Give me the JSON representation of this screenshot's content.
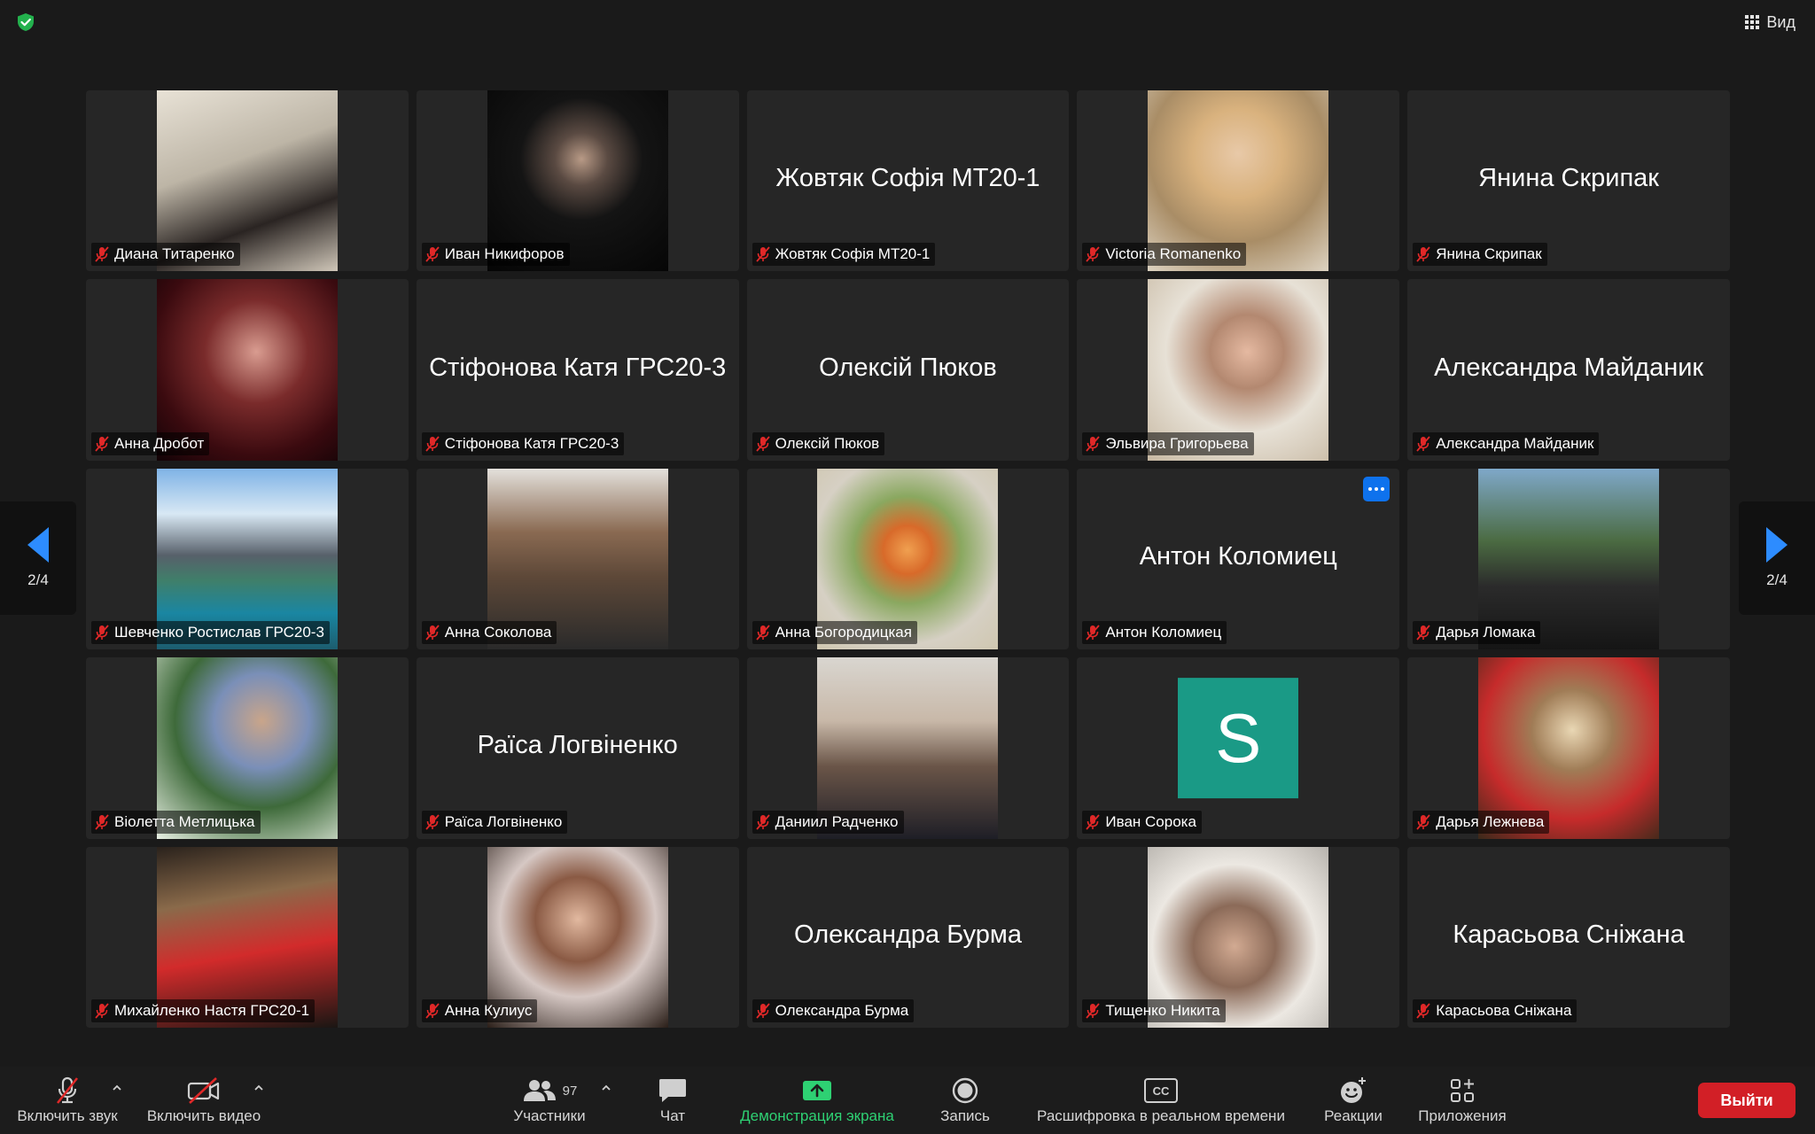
{
  "topbar": {
    "view_label": "Вид"
  },
  "pagination": {
    "left_label": "2/4",
    "right_label": "2/4"
  },
  "tiles": [
    {
      "name": "Диана Титаренко",
      "type": "video",
      "photo": "ph1"
    },
    {
      "name": "Иван Никифоров",
      "type": "video",
      "photo": "ph2"
    },
    {
      "name": "Жовтяк Софія МТ20-1",
      "type": "name",
      "big_name": "Жовтяк Софія МТ20-1"
    },
    {
      "name": "Victoria Romanenko",
      "type": "video",
      "photo": "ph3"
    },
    {
      "name": "Янина Скрипак",
      "type": "name",
      "big_name": "Янина Скрипак"
    },
    {
      "name": "Анна Дробот",
      "type": "video",
      "photo": "ph4"
    },
    {
      "name": "Стіфонова Катя ГРС20-3",
      "type": "name",
      "big_name": "Стіфонова Катя ГРС20-3"
    },
    {
      "name": "Олексій Пюков",
      "type": "name",
      "big_name": "Олексій Пюков"
    },
    {
      "name": "Эльвира Григорьева",
      "type": "video",
      "photo": "ph5"
    },
    {
      "name": "Александра Майданик",
      "type": "name",
      "big_name": "Александра Майданик"
    },
    {
      "name": "Шевченко Ростислав ГРС20-3",
      "type": "video",
      "photo": "ph6"
    },
    {
      "name": "Анна Соколова",
      "type": "video",
      "photo": "ph7"
    },
    {
      "name": "Анна Богородицкая",
      "type": "video",
      "photo": "ph8"
    },
    {
      "name": "Антон Коломиец",
      "type": "name",
      "big_name": "Антон Коломиец",
      "has_more": true
    },
    {
      "name": "Дарья Ломака",
      "type": "video",
      "photo": "ph9"
    },
    {
      "name": "Віолетта Метлицька",
      "type": "video",
      "photo": "ph10"
    },
    {
      "name": "Раїса Логвіненко",
      "type": "name",
      "big_name": "Раїса Логвіненко"
    },
    {
      "name": "Даниил Радченко",
      "type": "video",
      "photo": "ph11"
    },
    {
      "name": "Иван Сорока",
      "type": "avatar",
      "avatar_letter": "S"
    },
    {
      "name": "Дарья Лежнева",
      "type": "video",
      "photo": "ph12"
    },
    {
      "name": "Михайленко Настя ГРС20-1",
      "type": "video",
      "photo": "ph13"
    },
    {
      "name": "Анна Кулиус",
      "type": "video",
      "photo": "ph14"
    },
    {
      "name": "Олександра Бурма",
      "type": "name",
      "big_name": "Олександра Бурма"
    },
    {
      "name": "Тищенко Никита",
      "type": "video",
      "photo": "ph15"
    },
    {
      "name": "Карасьова Сніжана",
      "type": "name",
      "big_name": "Карасьова Сніжана"
    }
  ],
  "toolbar": {
    "unmute_label": "Включить звук",
    "start_video_label": "Включить видео",
    "participants_label": "Участники",
    "participants_count": "97",
    "chat_label": "Чат",
    "share_label": "Демонстрация экрана",
    "record_label": "Запись",
    "captions_label": "Расшифровка в реальном времени",
    "captions_icon_text": "CC",
    "reactions_label": "Реакции",
    "apps_label": "Приложения",
    "leave_label": "Выйти"
  },
  "colors": {
    "background": "#1a1a1a",
    "tile": "#262626",
    "accent_blue": "#2d8cff",
    "share_green": "#2ed173",
    "leave_red": "#d21f26",
    "mute_red": "#e02828",
    "avatar_teal": "#1a9a86"
  },
  "icons": {
    "security": "shield-check-icon",
    "view": "grid-view-icon",
    "mute": "microphone-muted-icon",
    "video_off": "video-camera-off-icon",
    "participants": "people-icon",
    "chat": "chat-bubble-icon",
    "share": "share-screen-arrow-icon",
    "record": "record-circle-icon",
    "captions": "closed-captions-icon",
    "reactions": "smiley-plus-icon",
    "apps": "apps-icon"
  }
}
